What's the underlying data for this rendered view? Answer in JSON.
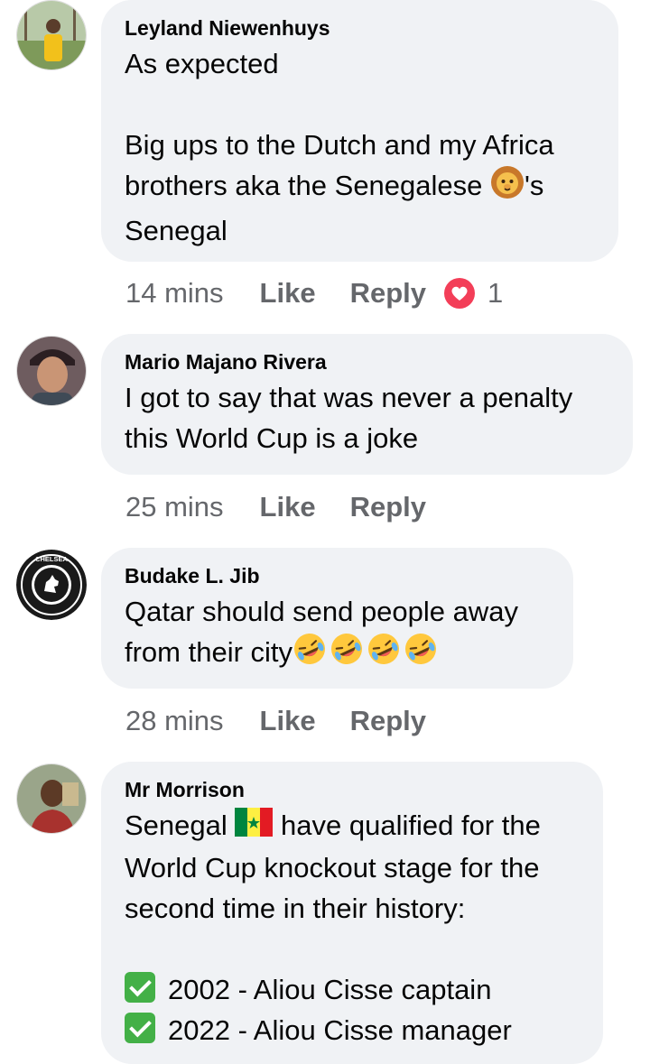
{
  "comments": [
    {
      "author": "Leyland Niewenhuys",
      "lines": [
        "As expected",
        "",
        "Big ups to the Dutch and my Africa",
        "brothers aka the Senegalese",
        "'s",
        "Senegal"
      ],
      "time": "14 mins",
      "like_label": "Like",
      "reply_label": "Reply",
      "reaction_count": "1"
    },
    {
      "author": "Mario Majano Rivera",
      "lines": [
        "I got to say that was never a penalty",
        "this World Cup is a joke"
      ],
      "time": "25 mins",
      "like_label": "Like",
      "reply_label": "Reply"
    },
    {
      "author": "Budake L. Jib",
      "lines": [
        "Qatar should send people away",
        "from their city"
      ],
      "avatar_text": "CHELSEA",
      "time": "28 mins",
      "like_label": "Like",
      "reply_label": "Reply"
    },
    {
      "author": "Mr Morrison",
      "lines": [
        "Senegal",
        "have qualified for the",
        "World Cup knockout stage for the",
        "second time in their history:",
        "",
        "2002 - Aliou Cisse captain",
        "2022 - Aliou Cisse manager"
      ]
    }
  ],
  "colors": {
    "bubble": "#f0f2f5",
    "meta_text": "#65676b",
    "heart": "#f33e58",
    "check": "#43b047"
  },
  "icons": [
    "lion-emoji-icon",
    "rolling-laughing-emoji-icon",
    "senegal-flag-icon",
    "check-mark-icon",
    "heart-reaction-icon"
  ]
}
